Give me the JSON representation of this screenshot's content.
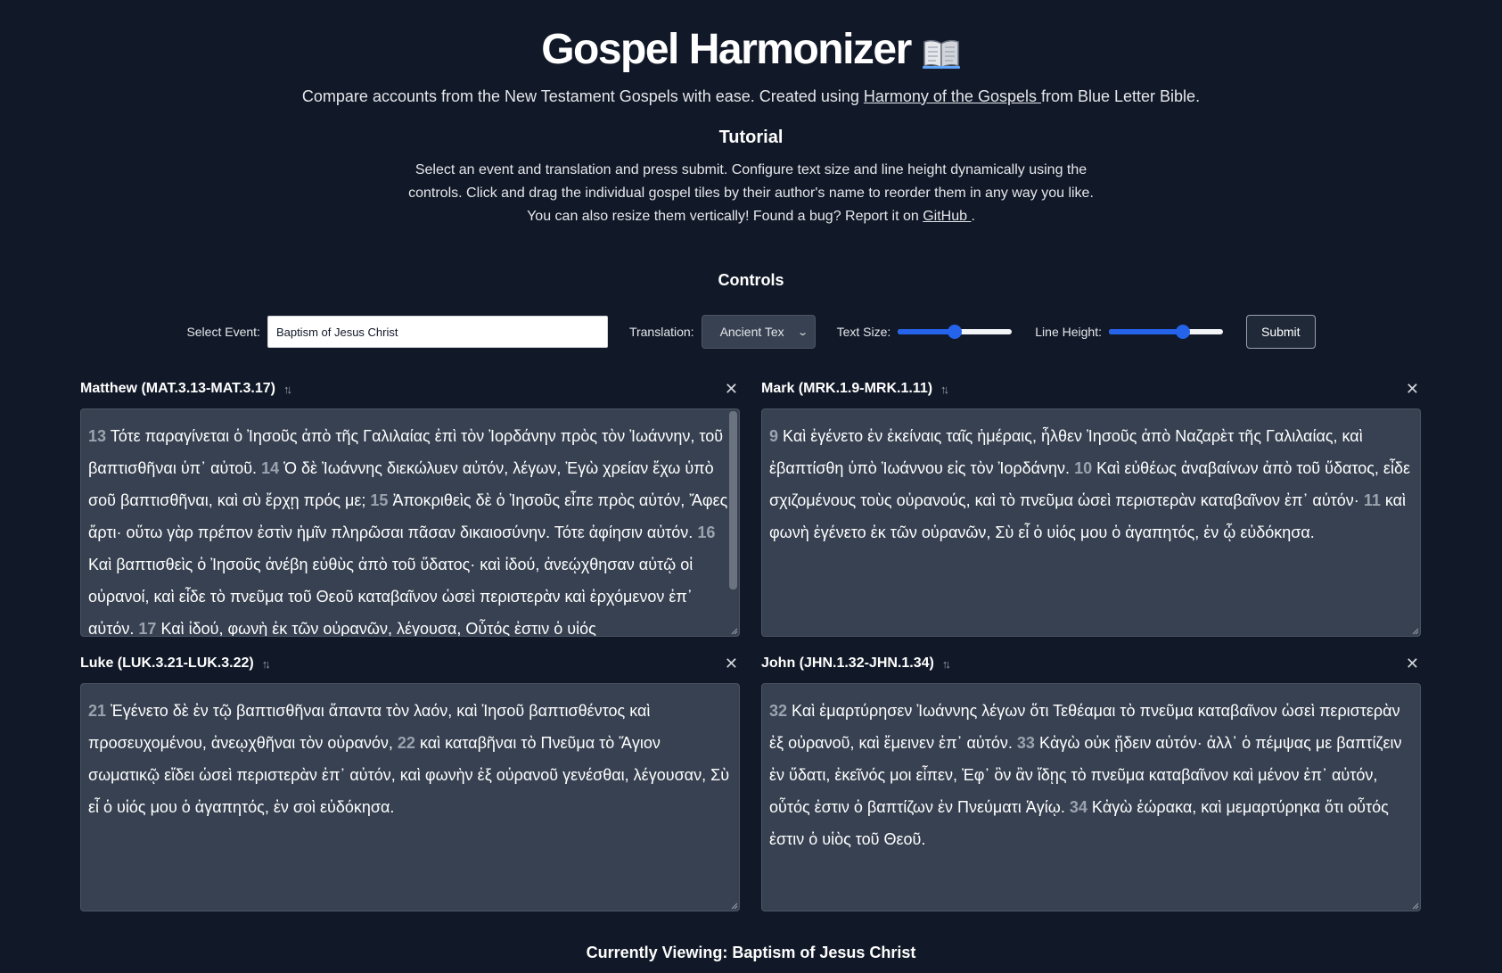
{
  "header": {
    "title": "Gospel Harmonizer",
    "icon": "open-book-icon",
    "subtitle_before": "Compare accounts from the New Testament Gospels with ease. Created using ",
    "subtitle_link": "Harmony of the Gospels ",
    "subtitle_after": "from Blue Letter Bible."
  },
  "tutorial": {
    "title": "Tutorial",
    "text_before": "Select an event and translation and press submit. Configure text size and line height dynamically using the controls. Click and drag the individual gospel tiles by their author's name to reorder them in any way you like. You can also resize them vertically! Found a bug? Report it on ",
    "link": "GitHub ",
    "text_after": "."
  },
  "controls": {
    "title": "Controls",
    "event_label": "Select Event:",
    "event_value": "Baptism of Jesus Christ",
    "translation_label": "Translation:",
    "translation_value": "Ancient Tex",
    "text_size_label": "Text Size:",
    "text_size_level": 0.5,
    "line_height_label": "Line Height:",
    "line_height_level": 0.65,
    "submit_label": "Submit"
  },
  "panels": [
    {
      "title": "Matthew (MAT.3.13-MAT.3.17)",
      "verses": [
        {
          "num": "13",
          "text": "Τότε παραγίνεται ὁ Ἰησοῦς ἀπὸ τῆς Γαλιλαίας ἐπὶ τὸν Ἰορδάνην πρὸς τὸν Ἰωάννην, τοῦ βαπτισθῆναι ὑπ᾽ αὐτοῦ."
        },
        {
          "num": "14",
          "text": "Ὁ δὲ Ἰωάννης διεκώλυεν αὐτόν, λέγων, Ἐγὼ χρείαν ἔχω ὑπὸ σοῦ βαπτισθῆναι, καὶ σὺ ἔρχῃ πρός με;"
        },
        {
          "num": "15",
          "text": "Ἀποκριθεὶς δὲ ὁ Ἰησοῦς εἶπε πρὸς αὐτόν, Ἄφες ἄρτι· οὕτω γὰρ πρέπον ἐστὶν ἡμῖν πληρῶσαι πᾶσαν δικαιοσύνην. Τότε ἀφίησιν αὐτόν."
        },
        {
          "num": "16",
          "text": "Καὶ βαπτισθεὶς ὁ Ἰησοῦς ἀνέβη εὐθὺς ἀπὸ τοῦ ὕδατος· καὶ ἰδού, ἀνεῴχθησαν αὐτῷ οἱ οὐρανοί, καὶ εἶδε τὸ πνεῦμα τοῦ Θεοῦ καταβαῖνον ὡσεὶ περιστερὰν καὶ ἐρχόμενον ἐπ᾽ αὐτόν."
        },
        {
          "num": "17",
          "text": "Καὶ ἰδού, φωνὴ ἐκ τῶν οὐρανῶν, λέγουσα, Οὗτός ἐστιν ὁ υἱός"
        }
      ]
    },
    {
      "title": "Mark (MRK.1.9-MRK.1.11)",
      "verses": [
        {
          "num": "9",
          "text": "Καὶ ἐγένετο ἐν ἐκείναις ταῖς ἡμέραις, ἦλθεν Ἰησοῦς ἀπὸ Ναζαρὲτ τῆς Γαλιλαίας, καὶ ἐβαπτίσθη ὑπὸ Ἰωάννου εἰς τὸν Ἰορδάνην."
        },
        {
          "num": "10",
          "text": "Καὶ εὐθέως ἀναβαίνων ἀπὸ τοῦ ὕδατος, εἶδε σχιζομένους τοὺς οὐρανούς, καὶ τὸ πνεῦμα ὡσεὶ περιστερὰν καταβαῖνον ἐπ᾽ αὐτόν·"
        },
        {
          "num": "11",
          "text": "καὶ φωνὴ ἐγένετο ἐκ τῶν οὐρανῶν, Σὺ εἶ ὁ υἱός μου ὁ ἀγαπητός, ἐν ᾧ εὐδόκησα."
        }
      ]
    },
    {
      "title": "Luke (LUK.3.21-LUK.3.22)",
      "verses": [
        {
          "num": "21",
          "text": "Ἐγένετο δὲ ἐν τῷ βαπτισθῆναι ἅπαντα τὸν λαόν, καὶ Ἰησοῦ βαπτισθέντος καὶ προσευχομένου, ἀνεῳχθῆναι τὸν οὐρανόν,"
        },
        {
          "num": "22",
          "text": "καὶ καταβῆναι τὸ Πνεῦμα τὸ Ἅγιον σωματικῷ εἴδει ὡσεὶ περιστερὰν ἐπ᾽ αὐτόν, καὶ φωνὴν ἐξ οὐρανοῦ γενέσθαι, λέγουσαν, Σὺ εἶ ὁ υἱός μου ὁ ἀγαπητός, ἐν σοὶ εὐδόκησα."
        }
      ]
    },
    {
      "title": "John (JHN.1.32-JHN.1.34)",
      "verses": [
        {
          "num": "32",
          "text": "Καὶ ἐμαρτύρησεν Ἰωάννης λέγων ὅτι Τεθέαμαι τὸ πνεῦμα καταβαῖνον ὡσεὶ περιστερὰν ἐξ οὐρανοῦ, καὶ ἔμεινεν ἐπ᾽ αὐτόν."
        },
        {
          "num": "33",
          "text": "Κἀγὼ οὐκ ᾔδειν αὐτόν· ἀλλ᾽ ὁ πέμψας με βαπτίζειν ἐν ὕδατι, ἐκεῖνός μοι εἶπεν, Ἐφ᾽ ὃν ἂν ἴδῃς τὸ πνεῦμα καταβαῖνον καὶ μένον ἐπ᾽ αὐτόν, οὗτός ἐστιν ὁ βαπτίζων ἐν Πνεύματι Ἁγίῳ."
        },
        {
          "num": "34",
          "text": "Κἀγὼ ἑώρακα, καὶ μεμαρτύρηκα ὅτι οὗτός ἐστιν ὁ υἱὸς τοῦ Θεοῦ."
        }
      ]
    }
  ],
  "footer": {
    "label": "Currently Viewing: Baptism of Jesus Christ"
  }
}
